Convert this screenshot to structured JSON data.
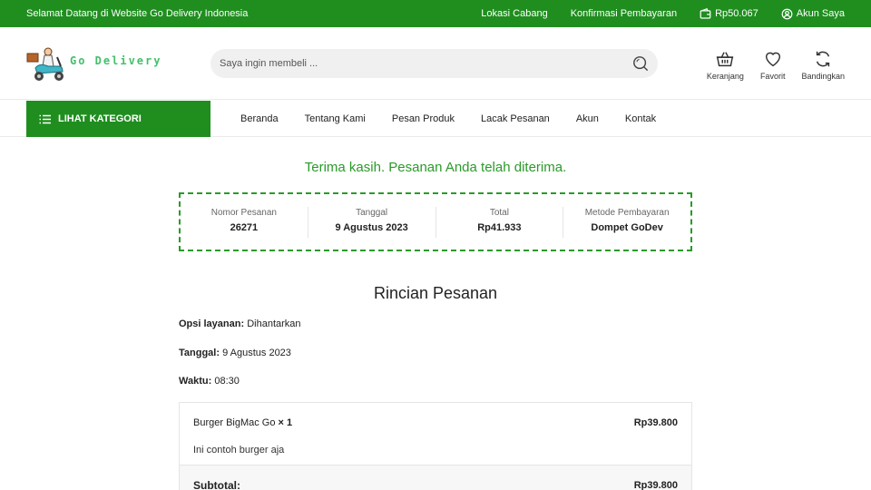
{
  "topbar": {
    "welcome": "Selamat Datang di Website Go Delivery Indonesia",
    "branch_location": "Lokasi Cabang",
    "payment_confirmation": "Konfirmasi Pembayaran",
    "wallet_balance": "Rp50.067",
    "my_account": "Akun Saya"
  },
  "header": {
    "logo_text": "Go Delivery",
    "search_placeholder": "Saya ingin membeli ...",
    "icons": {
      "cart": "Keranjang",
      "favorite": "Favorit",
      "compare": "Bandingkan"
    }
  },
  "nav": {
    "category_button": "LIHAT KATEGORI",
    "menu": [
      "Beranda",
      "Tentang Kami",
      "Pesan Produk",
      "Lacak Pesanan",
      "Akun",
      "Kontak"
    ]
  },
  "order": {
    "thanks_message": "Terima kasih. Pesanan Anda telah diterima.",
    "summary": [
      {
        "label": "Nomor Pesanan",
        "value": "26271"
      },
      {
        "label": "Tanggal",
        "value": "9 Agustus 2023"
      },
      {
        "label": "Total",
        "value": "Rp41.933"
      },
      {
        "label": "Metode Pembayaran",
        "value": "Dompet GoDev"
      }
    ],
    "details_title": "Rincian Pesanan",
    "service_option_label": "Opsi layanan:",
    "service_option_value": "Dihantarkan",
    "date_label": "Tanggal:",
    "date_value": "9 Agustus 2023",
    "time_label": "Waktu:",
    "time_value": "08:30",
    "items": [
      {
        "name": "Burger BigMac Go",
        "qty": "× 1",
        "price": "Rp39.800",
        "note": "Ini contoh burger aja"
      }
    ],
    "subtotal_label": "Subtotal:",
    "subtotal_value": "Rp39.800"
  },
  "colors": {
    "brand_green": "#1f8e1f",
    "accent_green": "#2a9a2a",
    "logo_green": "#43c06a"
  }
}
